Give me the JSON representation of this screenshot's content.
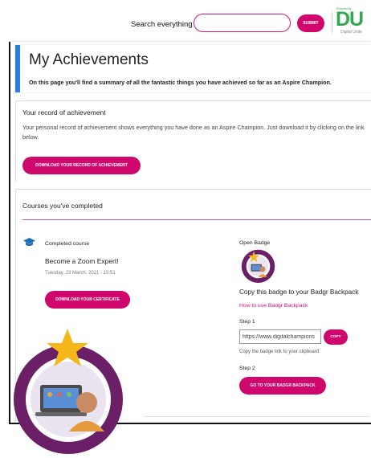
{
  "header": {
    "search_label": "Search everything",
    "search_placeholder": "",
    "submit_label": "SUBMIT",
    "logo_top": "Powered by",
    "logo_text": "DU",
    "logo_bottom": "Digital Unite"
  },
  "page": {
    "title": "My Achievements",
    "intro": "On this page you'll find a summary of all the fantastic things you have achieved so far as an Aspire Champion."
  },
  "record": {
    "title": "Your record of achievement",
    "description": "Your personal record of achievement shows everything you have done as an Aspire Champion. Just download it by clicking on the link below.",
    "button_label": "DOWNLOAD YOUR RECORD OF ACHIEVEMENT"
  },
  "courses": {
    "title": "Courses you've completed",
    "completed_label": "Completed course",
    "course_name": "Become a Zoom Expert!",
    "course_date": "Tuesday, 23 March, 2021 - 15:51",
    "certificate_button": "DOWNLOAD YOUR CERTIFICATE"
  },
  "badge": {
    "label": "Open Badge",
    "copy_title": "Copy this badge to your Badgr Backpack",
    "how_to_link": "How to use Badgr Backpack",
    "step1": "Step 1",
    "url_value": "https://www.digitalchampions",
    "copy_button": "COPY",
    "clipboard_text": "Copy the badge link to your clipboard",
    "step2": "Step 2",
    "goto_button": "GO TO YOUR BADGR BACKPACK"
  },
  "colors": {
    "accent_pink": "#d0086e",
    "title_accent_blue": "#2c7be5",
    "logo_green": "#33a851",
    "badge_purple": "#6b1f66"
  },
  "icons": {
    "graduation": "graduation-cap-icon",
    "badge": "open-badge-icon"
  }
}
